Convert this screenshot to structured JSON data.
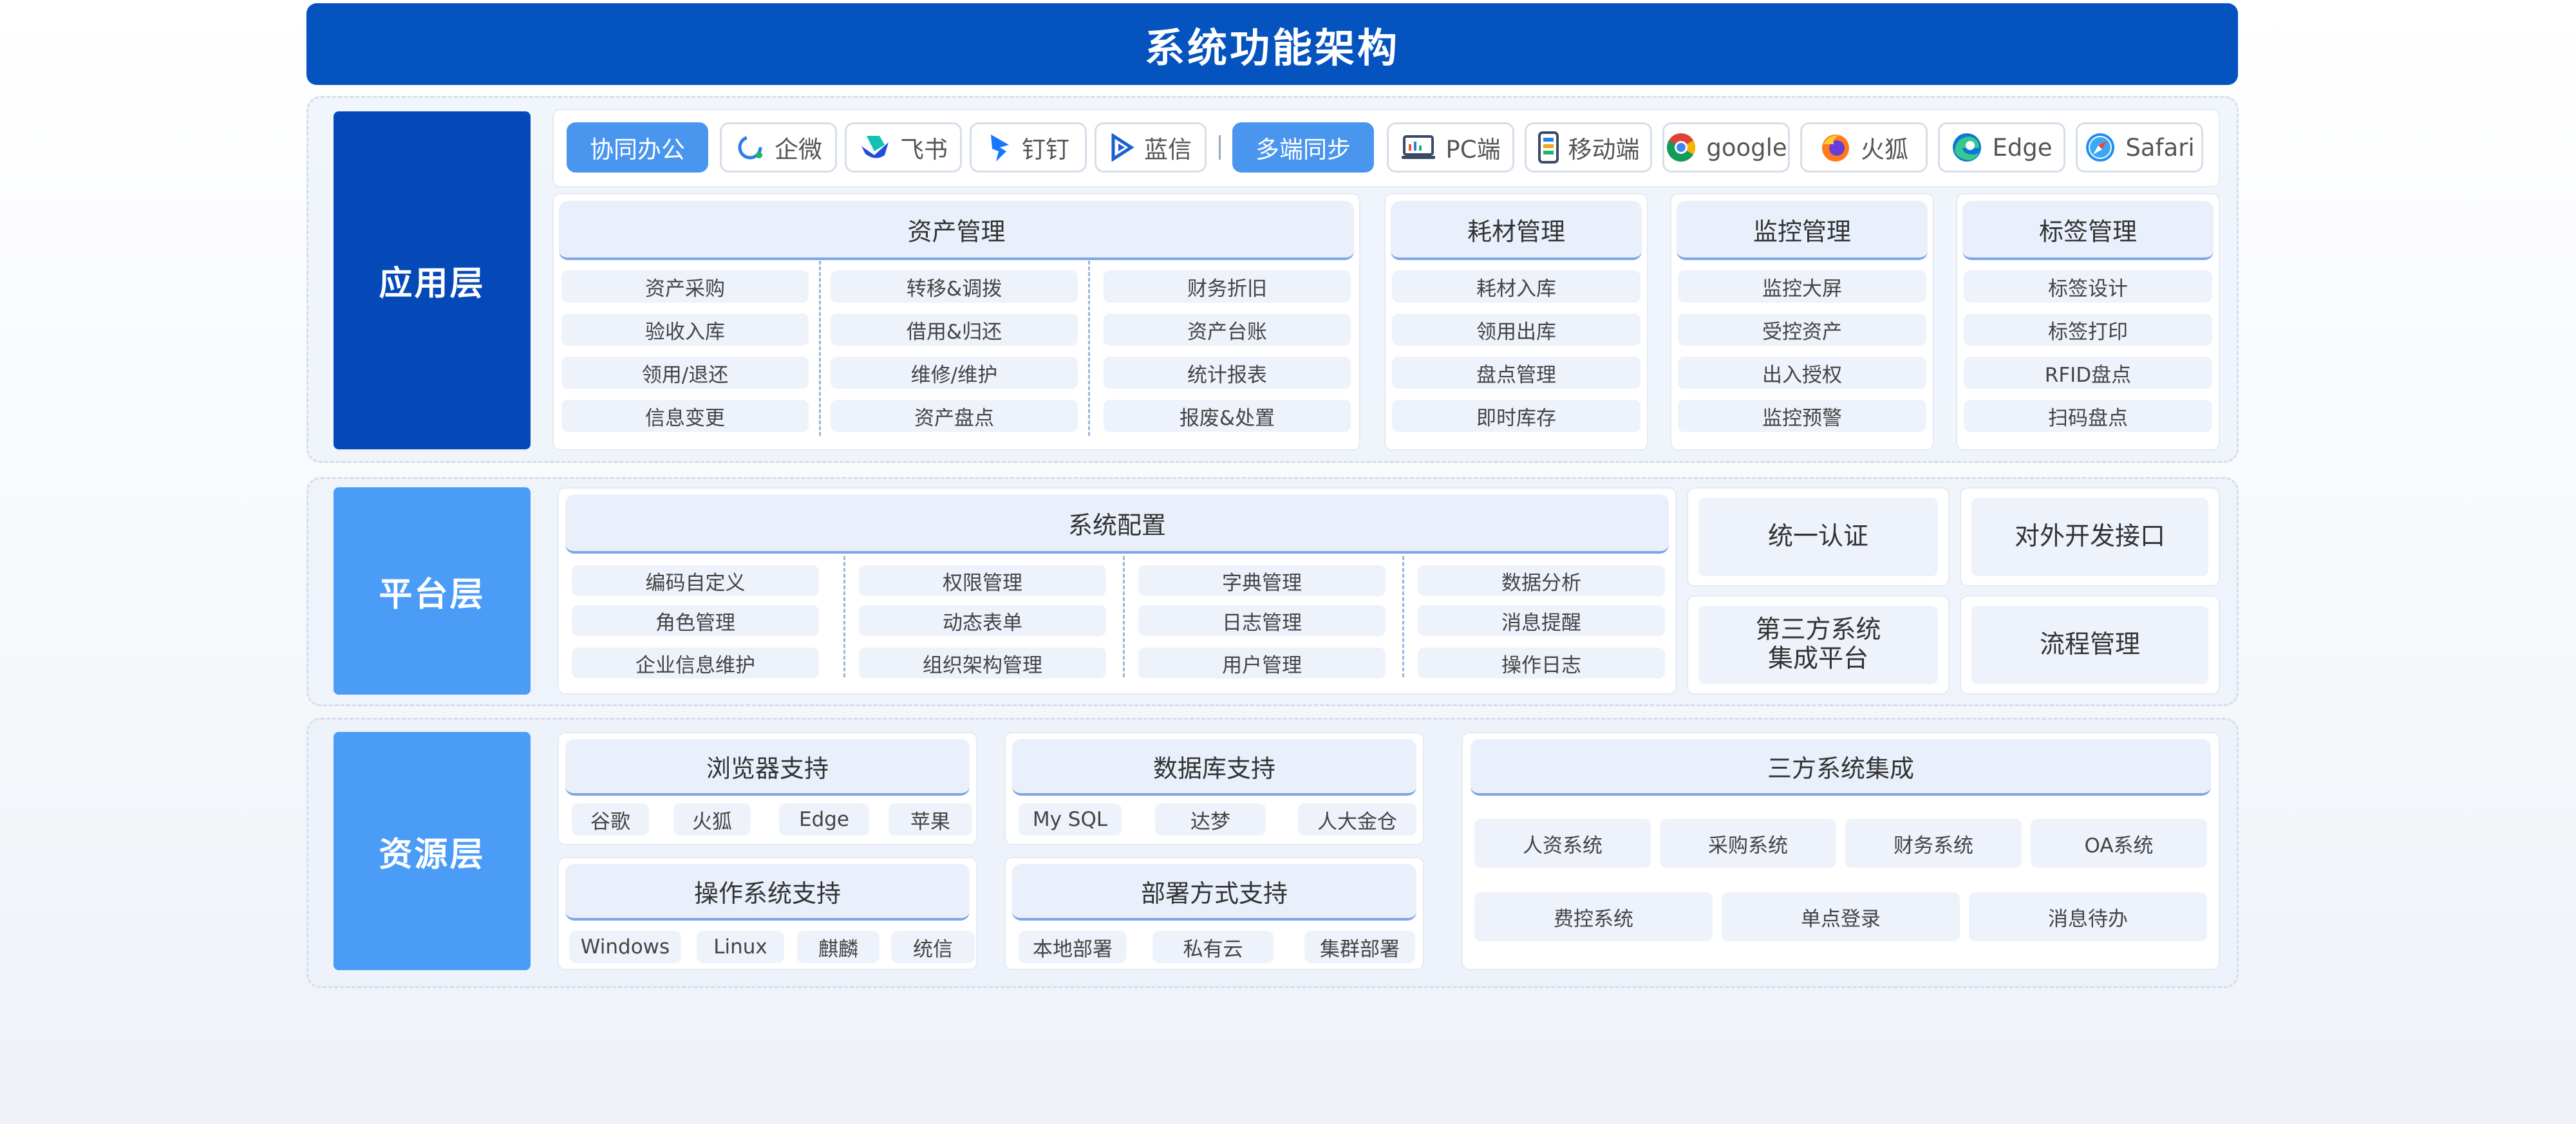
{
  "title": "系统功能架构",
  "colors": {
    "title_bg": "#0553bf",
    "app_label_bg": "#0549b8",
    "other_label_bg": "#4a9cf6",
    "primary_chip": "#4a96ee",
    "head_underline": "#7ea6e6"
  },
  "app_layer": {
    "label": "应用层",
    "clients": [
      {
        "label": "协同办公",
        "primary": true
      },
      {
        "label": "企微",
        "icon": "wecom-icon"
      },
      {
        "label": "飞书",
        "icon": "feishu-icon"
      },
      {
        "label": "钉钉",
        "icon": "dingtalk-icon"
      },
      {
        "label": "蓝信",
        "icon": "lanxin-icon"
      },
      {
        "label": "多端同步",
        "primary": true
      },
      {
        "label": "PC端",
        "icon": "pc-icon"
      },
      {
        "label": "移动端",
        "icon": "mobile-icon"
      },
      {
        "label": "google",
        "icon": "chrome-icon"
      },
      {
        "label": "火狐",
        "icon": "firefox-icon"
      },
      {
        "label": "Edge",
        "icon": "edge-icon"
      },
      {
        "label": "Safari",
        "icon": "safari-icon"
      }
    ],
    "asset": {
      "title": "资产管理",
      "columns": [
        [
          "资产采购",
          "验收入库",
          "领用/退还",
          "信息变更"
        ],
        [
          "转移&调拨",
          "借用&归还",
          "维修/维护",
          "资产盘点"
        ],
        [
          "财务折旧",
          "资产台账",
          "统计报表",
          "报废&处置"
        ]
      ]
    },
    "consumable": {
      "title": "耗材管理",
      "items": [
        "耗材入库",
        "领用出库",
        "盘点管理",
        "即时库存"
      ]
    },
    "monitor": {
      "title": "监控管理",
      "items": [
        "监控大屏",
        "受控资产",
        "出入授权",
        "监控预警"
      ]
    },
    "tag": {
      "title": "标签管理",
      "items": [
        "标签设计",
        "标签打印",
        "RFID盘点",
        "扫码盘点"
      ]
    }
  },
  "platform_layer": {
    "label": "平台层",
    "config": {
      "title": "系统配置",
      "columns": [
        [
          "编码自定义",
          "角色管理",
          "企业信息维护"
        ],
        [
          "权限管理",
          "动态表单",
          "组织架构管理"
        ],
        [
          "字典管理",
          "日志管理",
          "用户管理"
        ],
        [
          "数据分析",
          "消息提醒",
          "操作日志"
        ]
      ]
    },
    "side": [
      "统一认证",
      "对外开发接口",
      "第三方系统\n集成平台",
      "流程管理"
    ]
  },
  "resource_layer": {
    "label": "资源层",
    "browser": {
      "title": "浏览器支持",
      "items": [
        "谷歌",
        "火狐",
        "Edge",
        "苹果"
      ]
    },
    "database": {
      "title": "数据库支持",
      "items": [
        "My SQL",
        "达梦",
        "人大金仓"
      ]
    },
    "os": {
      "title": "操作系统支持",
      "items": [
        "Windows",
        "Linux",
        "麒麟",
        "统信"
      ]
    },
    "deploy": {
      "title": "部署方式支持",
      "items": [
        "本地部署",
        "私有云",
        "集群部署"
      ]
    },
    "integration": {
      "title": "三方系统集成",
      "row1": [
        "人资系统",
        "采购系统",
        "财务系统",
        "OA系统"
      ],
      "row2": [
        "费控系统",
        "单点登录",
        "消息待办"
      ]
    }
  }
}
